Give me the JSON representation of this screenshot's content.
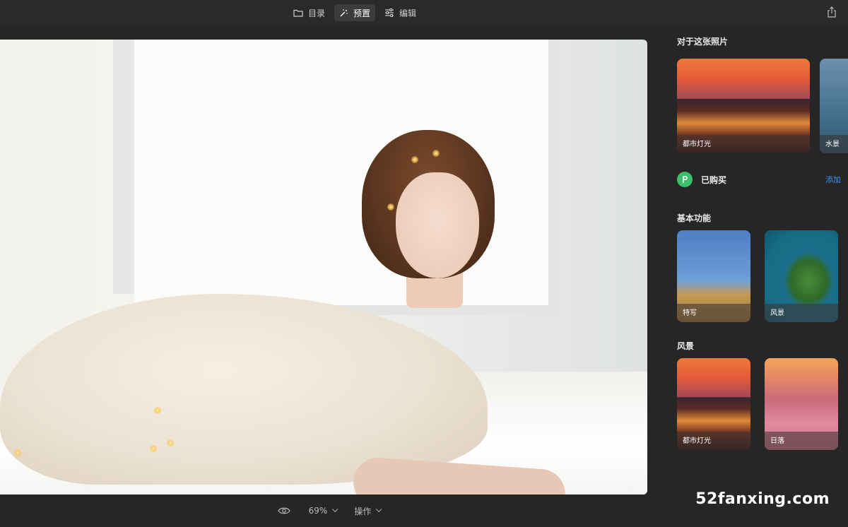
{
  "toolbar": {
    "tabs": [
      {
        "label": "目录",
        "icon": "folder-icon"
      },
      {
        "label": "预置",
        "icon": "magic-wand-icon",
        "active": true
      },
      {
        "label": "编辑",
        "icon": "sliders-icon"
      }
    ],
    "share_icon": "share-icon"
  },
  "bottom": {
    "eye_icon": "eye-icon",
    "zoom": "69%",
    "actions_label": "操作"
  },
  "watermark": "52fanxing.com",
  "panel": {
    "for_this_photo": {
      "title": "对于这张照片",
      "cards": [
        {
          "label": "都市灯光"
        },
        {
          "label": "水景"
        }
      ]
    },
    "purchased": {
      "label": "已购买",
      "add_label": "添加",
      "accent": "#3bbf6a"
    },
    "basic": {
      "title": "基本功能",
      "cards": [
        {
          "label": "特写"
        },
        {
          "label": "风景"
        }
      ]
    },
    "landscape": {
      "title": "风景",
      "cards": [
        {
          "label": "都市灯光"
        },
        {
          "label": "日落"
        }
      ]
    }
  },
  "colors": {
    "background": "#262626",
    "active_tab": "#3c3c3c",
    "link_blue": "#3d8ef0"
  }
}
